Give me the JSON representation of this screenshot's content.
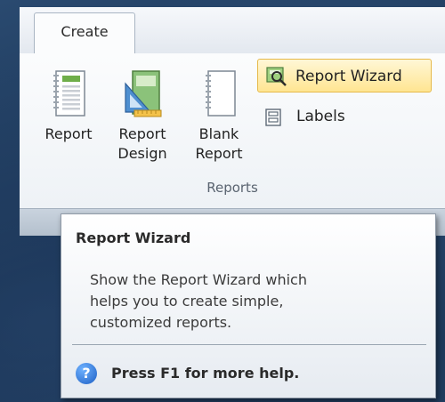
{
  "ribbon": {
    "active_tab": "Create",
    "group_label": "Reports",
    "commands": {
      "report": [
        "Report"
      ],
      "report_design": [
        "Report",
        "Design"
      ],
      "blank_report": [
        "Blank",
        "Report"
      ],
      "report_wizard": "Report Wizard",
      "labels": "Labels"
    }
  },
  "tooltip": {
    "title": "Report Wizard",
    "body_lines": [
      "Show the Report Wizard which",
      "helps you to create simple,",
      "customized reports."
    ],
    "help_text": "Press F1 for more help."
  },
  "colors": {
    "highlight": "#ffe592",
    "highlight_border": "#e6b94a",
    "help_icon": "#1d5fc4",
    "desktop": "#1d3553"
  },
  "icons": {
    "report": "report-icon",
    "report_design": "report-design-icon",
    "blank_report": "blank-report-icon",
    "report_wizard": "report-wizard-icon",
    "labels": "labels-icon",
    "help": "help-icon"
  }
}
